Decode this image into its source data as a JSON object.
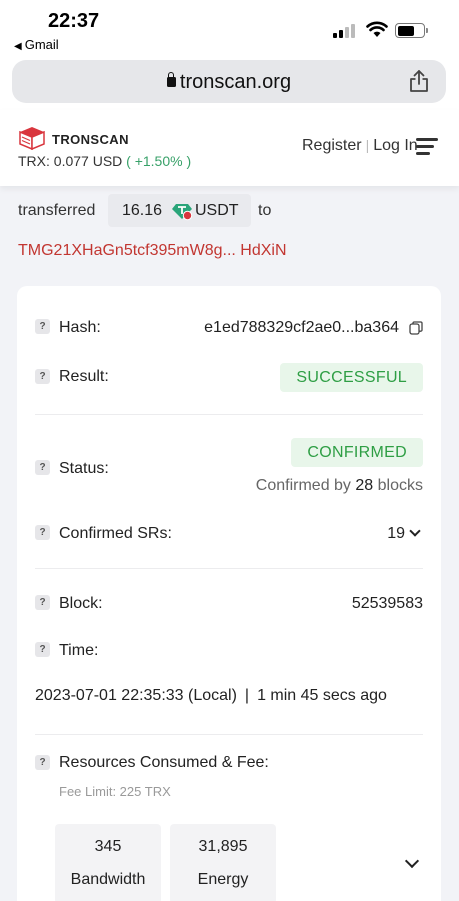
{
  "status_bar": {
    "time": "22:37",
    "back_app": "Gmail",
    "battery_level": 0.65
  },
  "browser": {
    "url": "tronscan.org"
  },
  "header": {
    "brand": "TRONSCAN",
    "price_label": "TRX: 0.077 USD",
    "price_change": "( +1.50% )",
    "register": "Register",
    "separator": "|",
    "login": "Log In"
  },
  "transfer": {
    "prefix": "transferred",
    "amount": "16.16",
    "token": "USDT",
    "to_word": "to",
    "to_address": "TMG21XHaGn5tcf395mW8g... HdXiN"
  },
  "details": {
    "qmark": "?",
    "hash_label": "Hash:",
    "hash_value": "e1ed788329cf2ae0...ba364",
    "result_label": "Result:",
    "result_value": "SUCCESSFUL",
    "status_label": "Status:",
    "status_value": "CONFIRMED",
    "confirmed_by_prefix": "Confirmed by",
    "confirmed_blocks": "28",
    "confirmed_by_suffix": "blocks",
    "srs_label": "Confirmed SRs:",
    "srs_value": "19",
    "block_label": "Block:",
    "block_value": "52539583",
    "time_label": "Time:",
    "time_local": "2023-07-01 22:35:33 (Local)",
    "time_sep": "|",
    "time_ago": "1 min 45 secs ago",
    "resources_label": "Resources Consumed & Fee:",
    "fee_limit": "Fee Limit: 225 TRX",
    "resources": [
      {
        "value": "345",
        "name": "Bandwidth"
      },
      {
        "value": "31,895",
        "name": "Energy"
      }
    ]
  },
  "colors": {
    "accent_red": "#c23631",
    "success_green": "#2e9e44",
    "success_bg": "#e8f6ea",
    "page_bg": "#f2f3f7"
  }
}
